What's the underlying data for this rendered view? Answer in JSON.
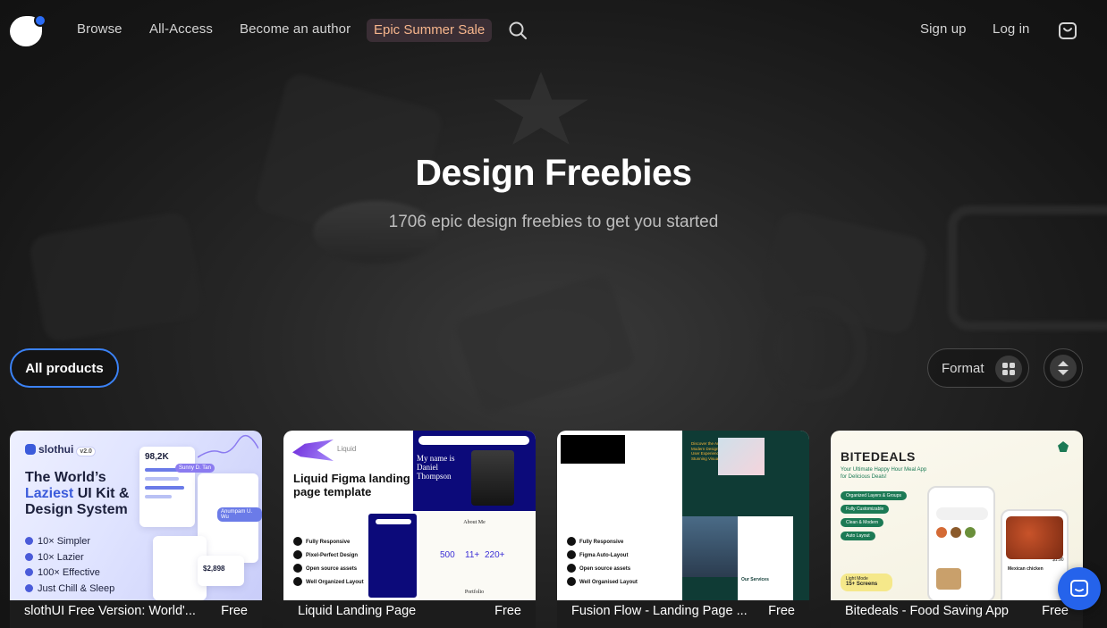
{
  "nav": {
    "logo": "logo-icon",
    "links": [
      "Browse",
      "All-Access",
      "Become an author"
    ],
    "sale": "Epic Summer Sale",
    "signup": "Sign up",
    "login": "Log in"
  },
  "hero": {
    "title": "Design Freebies",
    "subtitle": "1706 epic design freebies to get you started"
  },
  "filters": {
    "all_products": "All products",
    "format": "Format"
  },
  "cards": [
    {
      "name": "slothUI Free Version: World'...",
      "price": "Free",
      "thumb": {
        "brand": "slothui",
        "version": "v2.0",
        "head_a": "The World’s",
        "head_b": "Laziest",
        "head_c": "UI Kit &",
        "head_d": "Design System",
        "bullets": [
          "10× Simpler",
          "10× Lazier",
          "100× Effective",
          "Just Chill & Sleep"
        ],
        "stat": "98,2K",
        "stat2": "$2,898",
        "tag1": "Sunny D. Tan",
        "tag2": "Anumpam U. Wu"
      }
    },
    {
      "name": "Liquid Landing Page",
      "price": "Free",
      "thumb": {
        "logo_text": "Liquid",
        "title": "Liquid Figma landing page template",
        "features": [
          "Fully Responsive",
          "Pixel-Perfect Design",
          "Open source assets",
          "Well Organized Layout"
        ],
        "hero_text": "My name is Daniel Thompson",
        "about": "About Me",
        "stats": [
          "500",
          "11+",
          "220+"
        ],
        "portfolio": "Portfolio"
      }
    },
    {
      "name": "Fusion Flow - Landing Page ...",
      "price": "Free",
      "thumb": {
        "features": [
          "Fully Responsive",
          "Figma Auto-Layout",
          "Open source assets",
          "Well Organised Layout"
        ],
        "headline": "Discover the Art of Modern Design Where User Experience Meets Stunning Visuals",
        "services": "Our Services"
      }
    },
    {
      "name": "Bitedeals - Food Saving App",
      "price": "Free",
      "thumb": {
        "title": "BITEDEALS",
        "subtitle": "Your Ultimate Happy Hour Meal App for Delicious Deals!",
        "pills": [
          "Organized Layers & Groups",
          "Fully Customizable",
          "Clean & Modern",
          "Auto Layout"
        ],
        "badge_a": "Light Mode",
        "badge_b": "15+ Screens",
        "dish": "Mexican chicken",
        "dish_price": "$1.90"
      }
    }
  ],
  "colors": {
    "accent": "#2b6cf6",
    "sale_text": "#f6b58c",
    "sale_bg": "#3a2e35",
    "active_filter_border": "#3b82f6"
  },
  "icons": [
    "search-icon",
    "cart-icon",
    "grid-icon",
    "sort-icon",
    "chat-icon"
  ]
}
